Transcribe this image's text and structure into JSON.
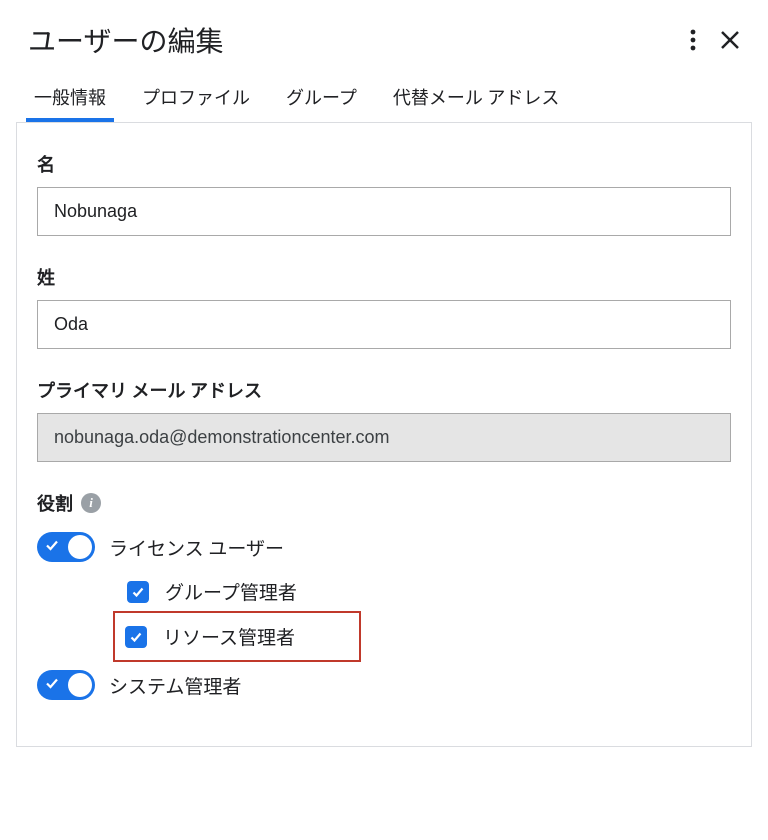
{
  "header": {
    "title": "ユーザーの編集"
  },
  "tabs": {
    "general": "一般情報",
    "profile": "プロファイル",
    "groups": "グループ",
    "altEmail": "代替メール アドレス"
  },
  "fields": {
    "firstNameLabel": "名",
    "firstNameValue": "Nobunaga",
    "lastNameLabel": "姓",
    "lastNameValue": "Oda",
    "primaryEmailLabel": "プライマリ メール アドレス",
    "primaryEmailValue": "nobunaga.oda@demonstrationcenter.com"
  },
  "roles": {
    "sectionLabel": "役割",
    "licenseUser": "ライセンス ユーザー",
    "groupAdmin": "グループ管理者",
    "resourceAdmin": "リソース管理者",
    "systemAdmin": "システム管理者"
  }
}
